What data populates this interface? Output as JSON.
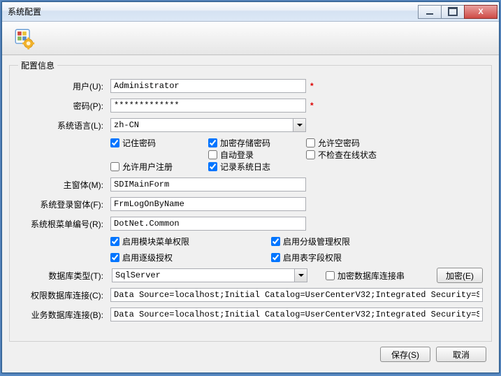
{
  "window": {
    "title": "系统配置"
  },
  "group": {
    "legend": "配置信息"
  },
  "labels": {
    "user": "用户(U):",
    "password": "密码(P):",
    "language": "系统语言(L):",
    "mainform": "主窗体(M):",
    "logonform": "系统登录窗体(F):",
    "rootmenu": "系统根菜单编号(R):",
    "dbtype": "数据库类型(T):",
    "permdb": "权限数据库连接(C):",
    "bizdb": "业务数据库连接(B):"
  },
  "values": {
    "user": "Administrator",
    "password": "*************",
    "language": "zh-CN",
    "mainform": "SDIMainForm",
    "logonform": "FrmLogOnByName",
    "rootmenu": "DotNet.Common",
    "dbtype": "SqlServer",
    "connstr": "Data Source=localhost;Initial Catalog=UserCenterV32;Integrated Security=SSPI;"
  },
  "checks": {
    "remember": "记住密码",
    "encryptpwd": "加密存储密码",
    "allowempty": "允许空密码",
    "autologin": "自动登录",
    "nocheckonline": "不检查在线状态",
    "allowreg": "允许用户注册",
    "syslog": "记录系统日志",
    "moduleperm": "启用模块菜单权限",
    "orgperm": "启用分级管理权限",
    "cascadeperm": "启用逐级授权",
    "fieldperm": "启用表字段权限",
    "encryptconn": "加密数据库连接串"
  },
  "buttons": {
    "encrypt": "加密(E)",
    "save": "保存(S)",
    "cancel": "取消"
  }
}
